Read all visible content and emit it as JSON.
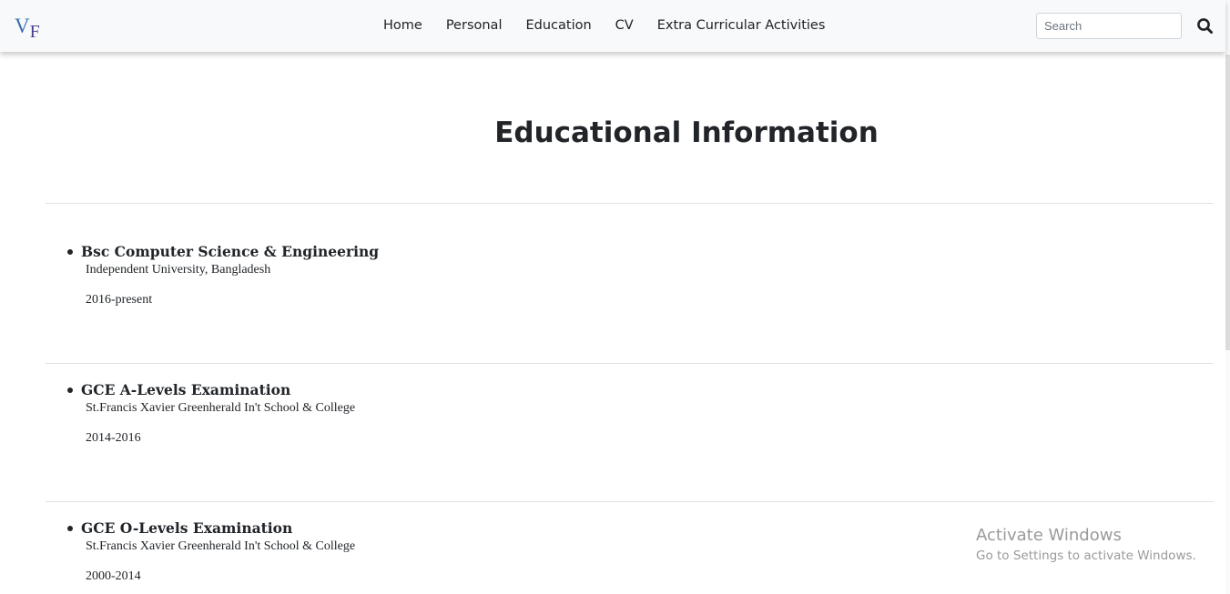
{
  "logo": {
    "text_v": "V",
    "text_f": "F"
  },
  "nav": {
    "links": [
      "Home",
      "Personal",
      "Education",
      "CV",
      "Extra Curricular Activities"
    ]
  },
  "search": {
    "placeholder": "Search",
    "value": "",
    "button_icon": "search-icon"
  },
  "page": {
    "title": "Educational Information"
  },
  "education": [
    {
      "title": "Bsc Computer Science & Engineering",
      "school": "Independent University, Bangladesh",
      "years": "2016-present"
    },
    {
      "title": "GCE A-Levels Examination",
      "school": "St.Francis Xavier Greenherald In't School & College",
      "years": "2014-2016"
    },
    {
      "title": "GCE O-Levels Examination",
      "school": "St.Francis Xavier Greenherald In't School & College",
      "years": "2000-2014"
    }
  ],
  "watermark": {
    "line1": "Activate Windows",
    "line2": "Go to Settings to activate Windows."
  },
  "colors": {
    "navbar_bg": "#f8f9fa",
    "logo_v": "#3a6fb0",
    "logo_f": "#4b3f92",
    "text": "#212529",
    "divider": "#e2e2e2"
  }
}
